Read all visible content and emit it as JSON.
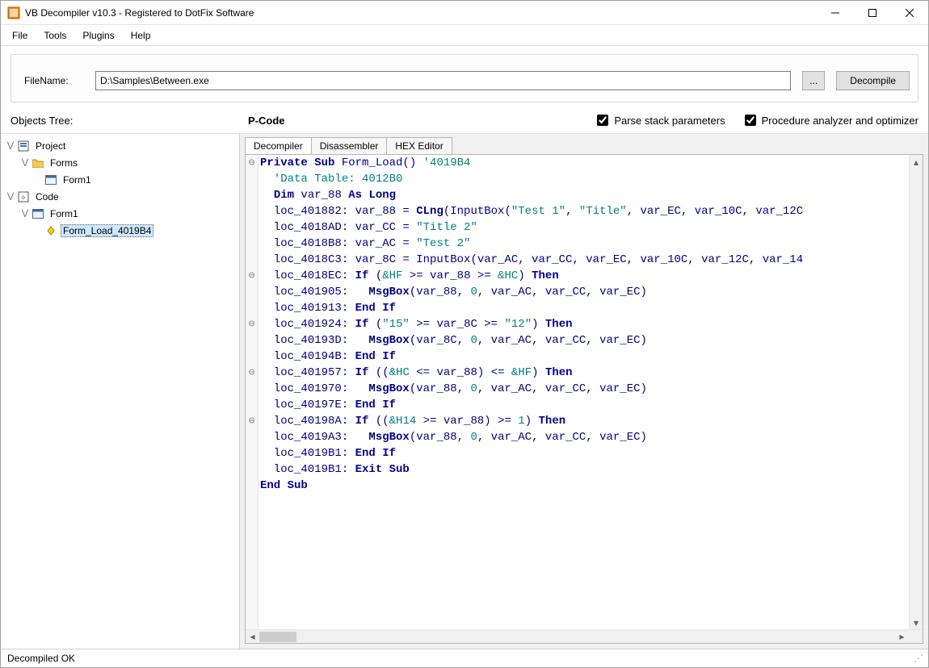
{
  "window": {
    "title": "VB Decompiler v10.3 - Registered to DotFix Software"
  },
  "menu": {
    "file": "File",
    "tools": "Tools",
    "plugins": "Plugins",
    "help": "Help"
  },
  "toolbar": {
    "filename_label": "FileName:",
    "filename_value": "D:\\Samples\\Between.exe",
    "browse_label": "...",
    "decompile_label": "Decompile"
  },
  "header": {
    "objects_tree": "Objects Tree:",
    "pcode": "P-Code",
    "parse_stack": "Parse stack parameters",
    "proc_analyzer": "Procedure analyzer and optimizer"
  },
  "tree": {
    "project": "Project",
    "forms": "Forms",
    "form1a": "Form1",
    "code": "Code",
    "form1b": "Form1",
    "form_load": "Form_Load_4019B4"
  },
  "tabs": {
    "decompiler": "Decompiler",
    "disassembler": "Disassembler",
    "hex_editor": "HEX Editor"
  },
  "status": {
    "text": "Decompiled OK"
  },
  "code": {
    "lines": [
      {
        "g": "⊖",
        "seg": [
          {
            "c": "kw",
            "t": "Private Sub"
          },
          {
            "c": "plain",
            "t": " Form_Load() "
          },
          {
            "c": "cmt",
            "t": "'4019B4"
          }
        ]
      },
      {
        "g": "",
        "seg": [
          {
            "c": "plain",
            "t": "  "
          },
          {
            "c": "cmt",
            "t": "'Data Table: 4012B0"
          }
        ]
      },
      {
        "g": "",
        "seg": [
          {
            "c": "plain",
            "t": "  "
          },
          {
            "c": "kw",
            "t": "Dim"
          },
          {
            "c": "plain",
            "t": " var_88 "
          },
          {
            "c": "kw",
            "t": "As Long"
          }
        ]
      },
      {
        "g": "",
        "seg": [
          {
            "c": "plain",
            "t": "  loc_401882: var_88 = "
          },
          {
            "c": "fn",
            "t": "CLng"
          },
          {
            "c": "plain",
            "t": "(InputBox("
          },
          {
            "c": "str",
            "t": "\"Test 1\""
          },
          {
            "c": "plain",
            "t": ", "
          },
          {
            "c": "str",
            "t": "\"Title\""
          },
          {
            "c": "plain",
            "t": ", var_EC, var_10C, var_12C"
          }
        ]
      },
      {
        "g": "",
        "seg": [
          {
            "c": "plain",
            "t": "  loc_4018AD: var_CC = "
          },
          {
            "c": "str",
            "t": "\"Title 2\""
          }
        ]
      },
      {
        "g": "",
        "seg": [
          {
            "c": "plain",
            "t": "  loc_4018B8: var_AC = "
          },
          {
            "c": "str",
            "t": "\"Test 2\""
          }
        ]
      },
      {
        "g": "",
        "seg": [
          {
            "c": "plain",
            "t": "  loc_4018C3: var_8C = InputBox(var_AC, var_CC, var_EC, var_10C, var_12C, var_14"
          }
        ]
      },
      {
        "g": "⊖",
        "seg": [
          {
            "c": "plain",
            "t": "  loc_4018EC: "
          },
          {
            "c": "kw",
            "t": "If"
          },
          {
            "c": "plain",
            "t": " ("
          },
          {
            "c": "num",
            "t": "&HF"
          },
          {
            "c": "plain",
            "t": " >= var_88 >= "
          },
          {
            "c": "num",
            "t": "&HC"
          },
          {
            "c": "plain",
            "t": ") "
          },
          {
            "c": "kw",
            "t": "Then"
          }
        ]
      },
      {
        "g": "",
        "seg": [
          {
            "c": "plain",
            "t": "  loc_401905:   "
          },
          {
            "c": "fn",
            "t": "MsgBox"
          },
          {
            "c": "plain",
            "t": "(var_88, "
          },
          {
            "c": "num",
            "t": "0"
          },
          {
            "c": "plain",
            "t": ", var_AC, var_CC, var_EC)"
          }
        ]
      },
      {
        "g": "",
        "seg": [
          {
            "c": "plain",
            "t": "  loc_401913: "
          },
          {
            "c": "kw",
            "t": "End If"
          }
        ]
      },
      {
        "g": "⊖",
        "seg": [
          {
            "c": "plain",
            "t": "  loc_401924: "
          },
          {
            "c": "kw",
            "t": "If"
          },
          {
            "c": "plain",
            "t": " ("
          },
          {
            "c": "str",
            "t": "\"15\""
          },
          {
            "c": "plain",
            "t": " >= var_8C >= "
          },
          {
            "c": "str",
            "t": "\"12\""
          },
          {
            "c": "plain",
            "t": ") "
          },
          {
            "c": "kw",
            "t": "Then"
          }
        ]
      },
      {
        "g": "",
        "seg": [
          {
            "c": "plain",
            "t": "  loc_40193D:   "
          },
          {
            "c": "fn",
            "t": "MsgBox"
          },
          {
            "c": "plain",
            "t": "(var_8C, "
          },
          {
            "c": "num",
            "t": "0"
          },
          {
            "c": "plain",
            "t": ", var_AC, var_CC, var_EC)"
          }
        ]
      },
      {
        "g": "",
        "seg": [
          {
            "c": "plain",
            "t": "  loc_40194B: "
          },
          {
            "c": "kw",
            "t": "End If"
          }
        ]
      },
      {
        "g": "⊖",
        "seg": [
          {
            "c": "plain",
            "t": "  loc_401957: "
          },
          {
            "c": "kw",
            "t": "If"
          },
          {
            "c": "plain",
            "t": " (("
          },
          {
            "c": "num",
            "t": "&HC"
          },
          {
            "c": "plain",
            "t": " <= var_88) <= "
          },
          {
            "c": "num",
            "t": "&HF"
          },
          {
            "c": "plain",
            "t": ") "
          },
          {
            "c": "kw",
            "t": "Then"
          }
        ]
      },
      {
        "g": "",
        "seg": [
          {
            "c": "plain",
            "t": "  loc_401970:   "
          },
          {
            "c": "fn",
            "t": "MsgBox"
          },
          {
            "c": "plain",
            "t": "(var_88, "
          },
          {
            "c": "num",
            "t": "0"
          },
          {
            "c": "plain",
            "t": ", var_AC, var_CC, var_EC)"
          }
        ]
      },
      {
        "g": "",
        "seg": [
          {
            "c": "plain",
            "t": "  loc_40197E: "
          },
          {
            "c": "kw",
            "t": "End If"
          }
        ]
      },
      {
        "g": "⊖",
        "seg": [
          {
            "c": "plain",
            "t": "  loc_40198A: "
          },
          {
            "c": "kw",
            "t": "If"
          },
          {
            "c": "plain",
            "t": " (("
          },
          {
            "c": "num",
            "t": "&H14"
          },
          {
            "c": "plain",
            "t": " >= var_88) >= "
          },
          {
            "c": "num",
            "t": "1"
          },
          {
            "c": "plain",
            "t": ") "
          },
          {
            "c": "kw",
            "t": "Then"
          }
        ]
      },
      {
        "g": "",
        "seg": [
          {
            "c": "plain",
            "t": "  loc_4019A3:   "
          },
          {
            "c": "fn",
            "t": "MsgBox"
          },
          {
            "c": "plain",
            "t": "(var_88, "
          },
          {
            "c": "num",
            "t": "0"
          },
          {
            "c": "plain",
            "t": ", var_AC, var_CC, var_EC)"
          }
        ]
      },
      {
        "g": "",
        "seg": [
          {
            "c": "plain",
            "t": "  loc_4019B1: "
          },
          {
            "c": "kw",
            "t": "End If"
          }
        ]
      },
      {
        "g": "",
        "seg": [
          {
            "c": "plain",
            "t": "  loc_4019B1: "
          },
          {
            "c": "kw",
            "t": "Exit Sub"
          }
        ]
      },
      {
        "g": "",
        "seg": [
          {
            "c": "kw",
            "t": "End Sub"
          }
        ]
      }
    ]
  }
}
